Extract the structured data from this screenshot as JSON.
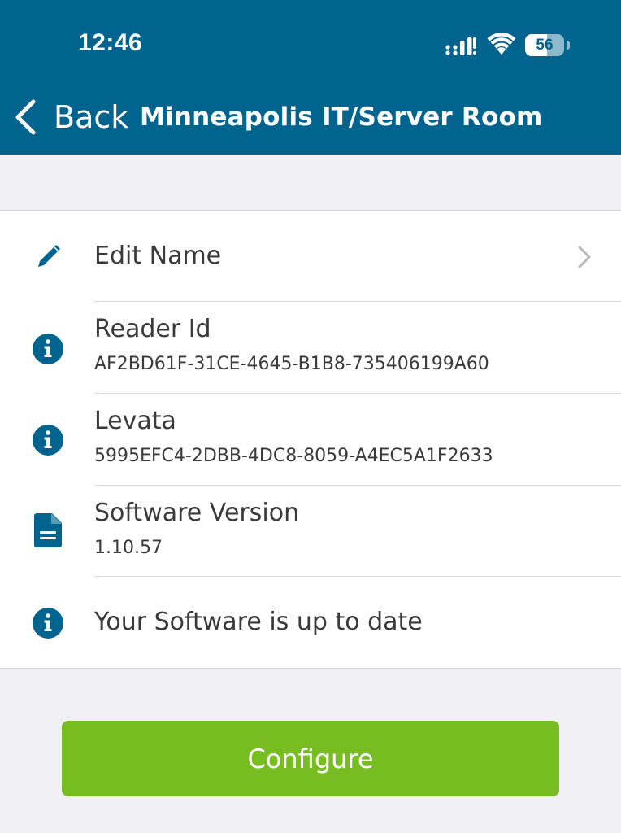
{
  "status_bar": {
    "time": "12:46",
    "battery": "56",
    "battery_level": 0.56
  },
  "nav": {
    "back_label": "Back",
    "title": "Minneapolis IT/Server Room"
  },
  "rows": [
    {
      "icon": "pencil-icon",
      "label": "Edit Name"
    },
    {
      "icon": "info-icon",
      "label": "Reader Id",
      "value": "AF2BD61F-31CE-4645-B1B8-735406199A60"
    },
    {
      "icon": "info-icon",
      "label": "Levata",
      "value": "5995EFC4-2DBB-4DC8-8059-A4EC5A1F2633"
    },
    {
      "icon": "document-icon",
      "label": "Software Version",
      "value": "1.10.57"
    },
    {
      "icon": "info-icon",
      "label": "Your Software is up to date"
    }
  ],
  "configure_label": "Configure",
  "colors": {
    "header": "#00648f",
    "accent": "#00648f",
    "button": "#77bd22"
  }
}
